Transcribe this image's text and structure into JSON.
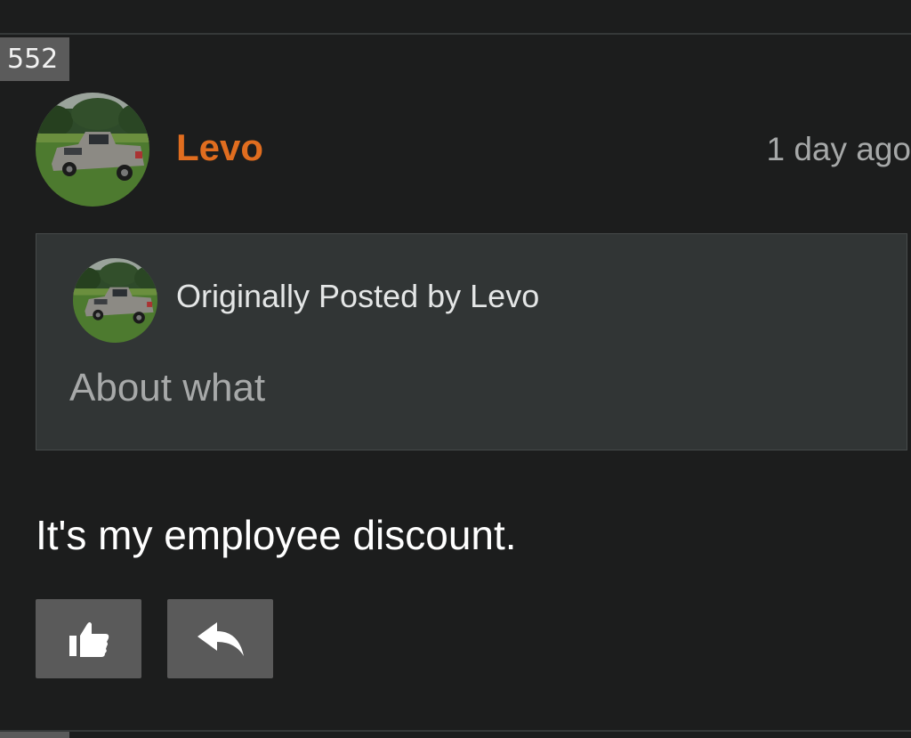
{
  "post": {
    "number": "552",
    "author": "Levo",
    "timestamp": "1 day ago",
    "body": "It's my employee discount."
  },
  "quote": {
    "attribution": "Originally Posted by Levo",
    "text": "About what"
  },
  "actions": {
    "like_icon": "thumbs-up-icon",
    "reply_icon": "reply-arrow-icon"
  },
  "colors": {
    "background": "#1c1d1d",
    "username": "#e06d1f",
    "quote_background": "#313535",
    "button_background": "#5a5a5a"
  }
}
